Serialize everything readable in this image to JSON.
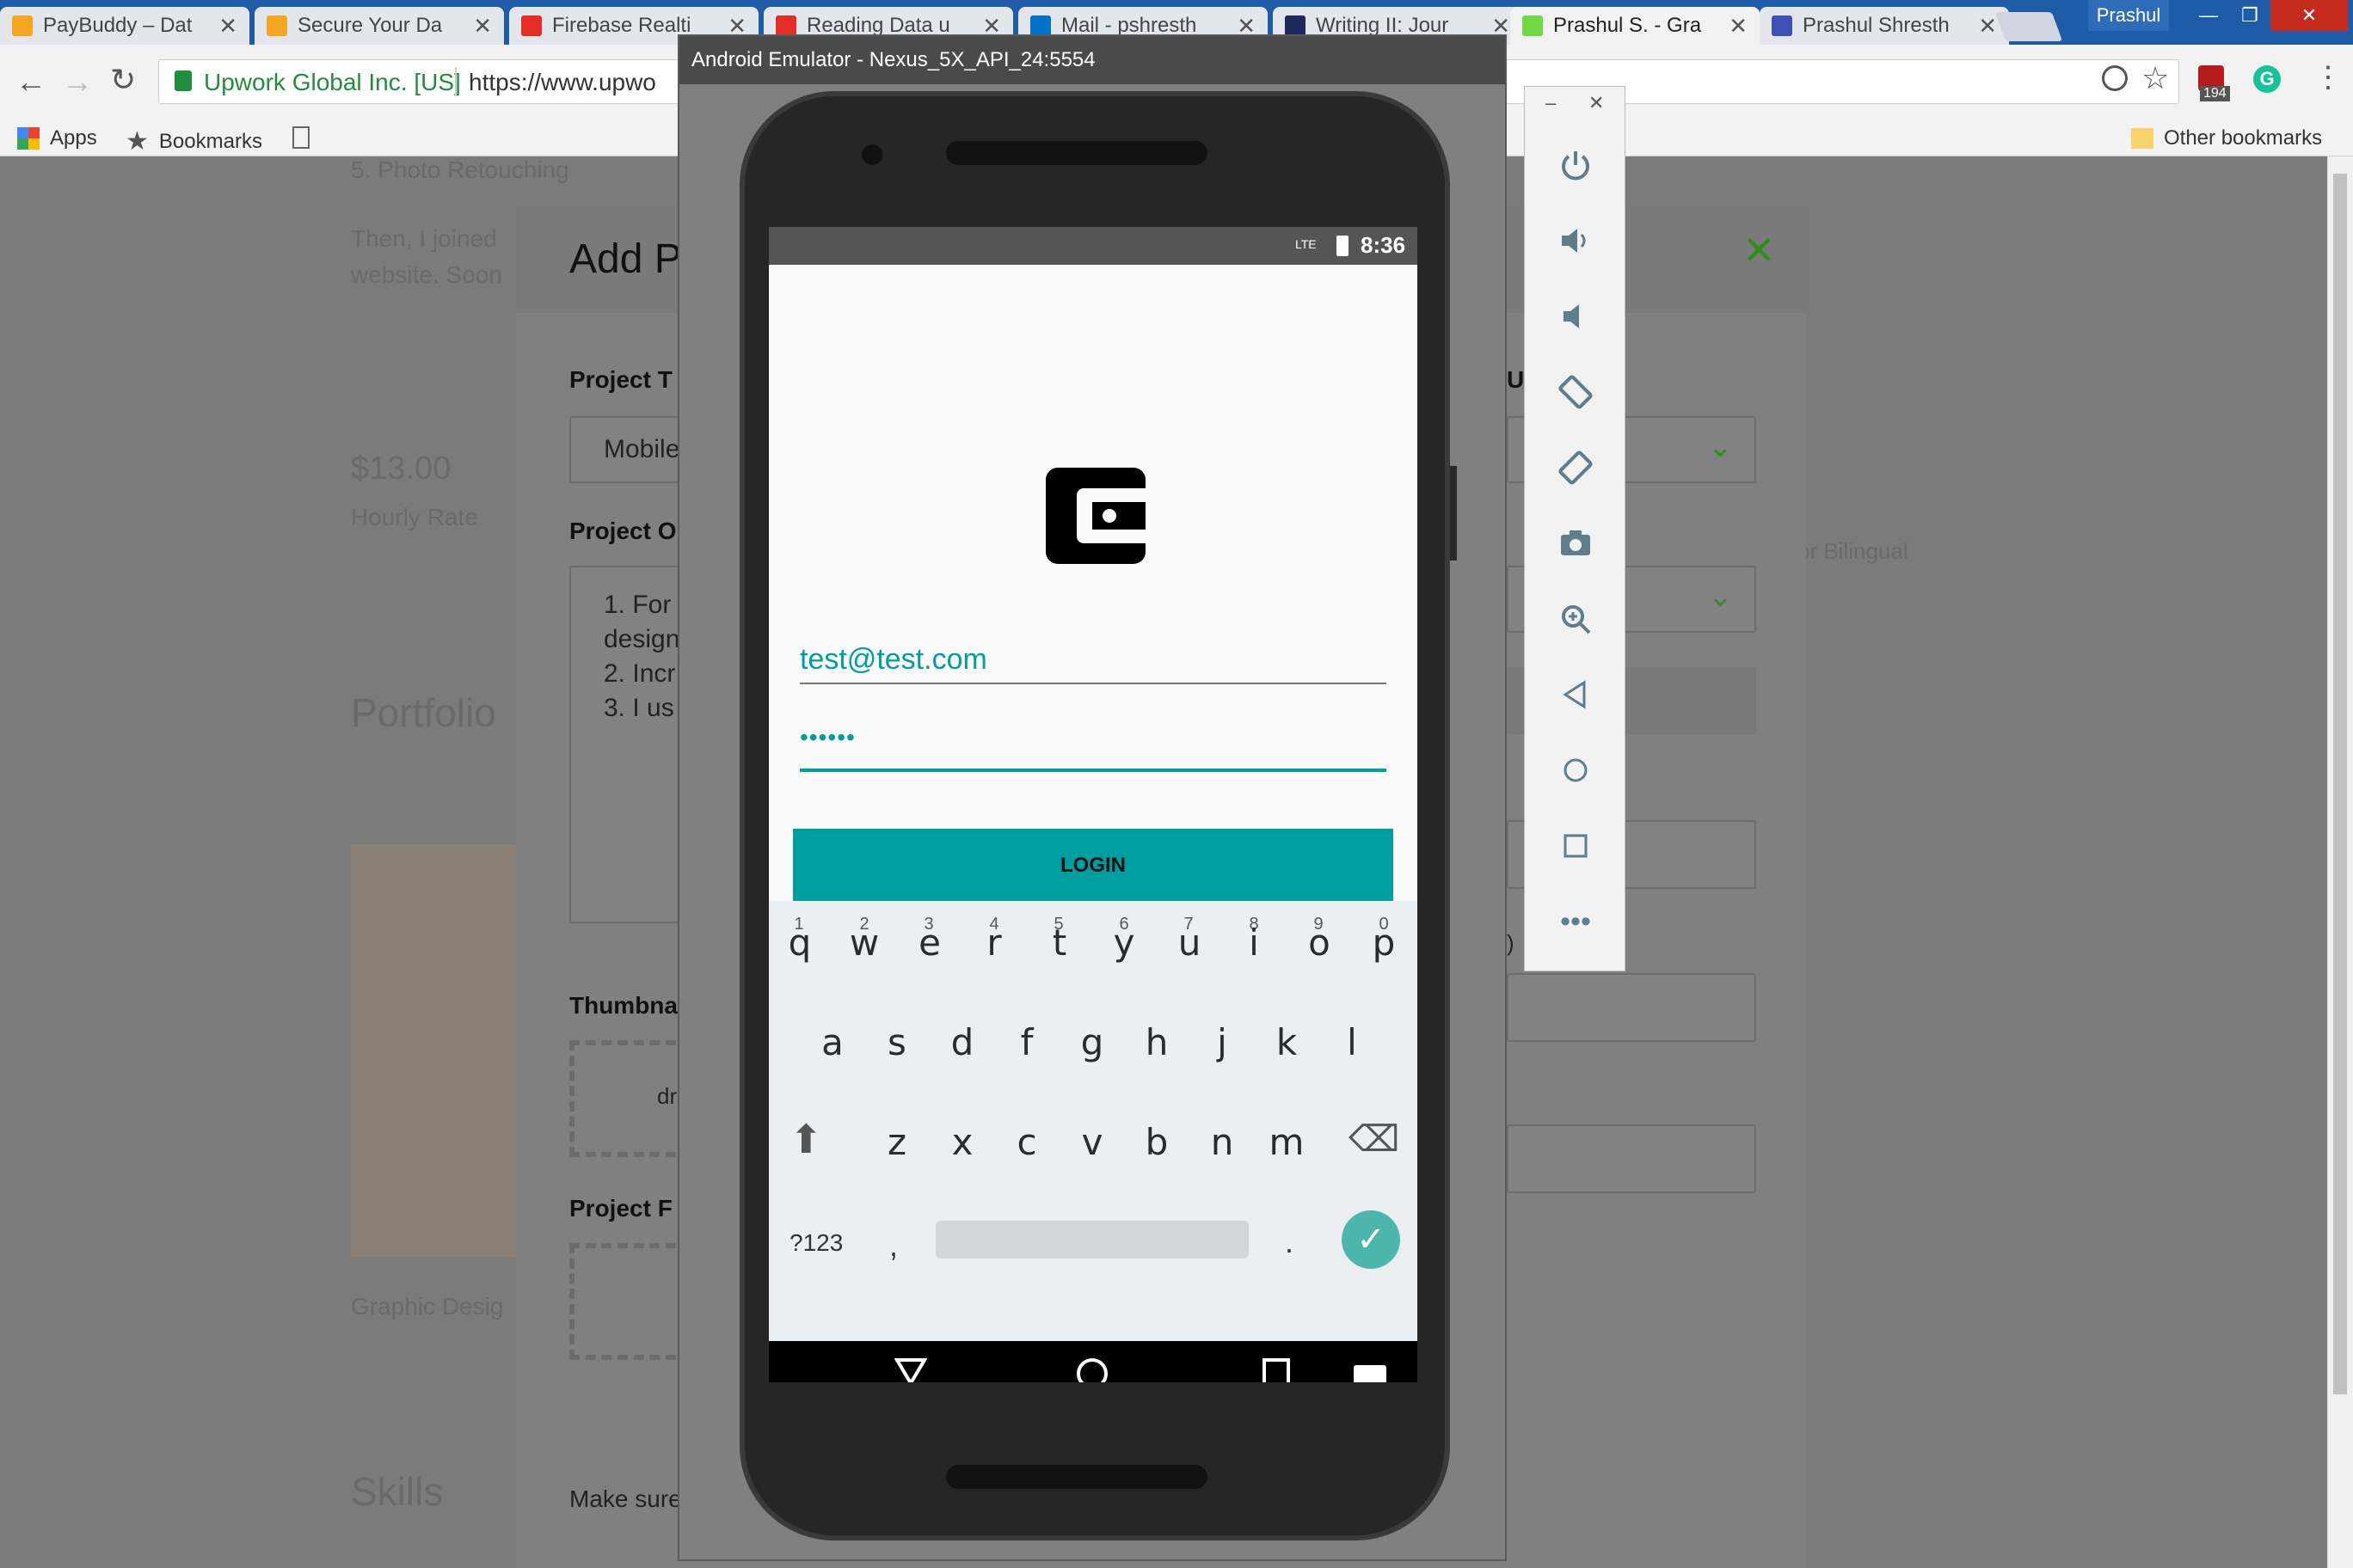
{
  "browser": {
    "tabs": [
      {
        "label": "PayBuddy – Dat",
        "icon": "firebase-icon"
      },
      {
        "label": "Secure Your Da",
        "icon": "firebase-icon"
      },
      {
        "label": "Firebase Realti",
        "icon": "youtube-icon"
      },
      {
        "label": "Reading Data u",
        "icon": "youtube-icon"
      },
      {
        "label": "Mail - pshresth",
        "icon": "outlook-icon"
      },
      {
        "label": "Writing II: Jour",
        "icon": "bookmark-icon"
      },
      {
        "label": "Prashul S. - Gra",
        "icon": "upwork-icon"
      },
      {
        "label": "Prashul Shresth",
        "icon": "site-icon"
      }
    ],
    "profile_name": "Prashul",
    "site_identity": "Upwork Global Inc. [US]",
    "url": "https://www.upwo",
    "extension_badge": "194",
    "bookmarks": {
      "apps": "Apps",
      "bookmarks": "Bookmarks",
      "other": "Other bookmarks"
    }
  },
  "background_page": {
    "item": "5. Photo Retouching",
    "para1": "Then, I joined",
    "para2": "website. Soon",
    "rate": "$13.00",
    "rate_label": "Hourly Rate",
    "portfolio": "Portfolio",
    "graphic": "Graphic Desig",
    "skills": "Skills",
    "bilingual": "or Bilingual"
  },
  "modal": {
    "title": "Add P",
    "project_title_label": "Project T",
    "project_title_value": "Mobile",
    "overview_label": "Project O",
    "overview_lines": [
      "1. For",
      "design",
      "2. Incr",
      "3. I us"
    ],
    "thumbnail_label": "Thumbna",
    "thumbnail_hint": "dr",
    "files_label": "Project F",
    "footer": "Make sure",
    "right_label": "Up",
    "right_paren": ")"
  },
  "emulator": {
    "title": "Android Emulator - Nexus_5X_API_24:5554",
    "status_network": "LTE",
    "time": "8:36",
    "email": "test@test.com",
    "password": "••••••",
    "login": "LOGIN",
    "keyboard": {
      "numbers": [
        "1",
        "2",
        "3",
        "4",
        "5",
        "6",
        "7",
        "8",
        "9",
        "0"
      ],
      "row1": [
        "q",
        "w",
        "e",
        "r",
        "t",
        "y",
        "u",
        "i",
        "o",
        "p"
      ],
      "row2": [
        "a",
        "s",
        "d",
        "f",
        "g",
        "h",
        "j",
        "k",
        "l"
      ],
      "row3": [
        "z",
        "x",
        "c",
        "v",
        "b",
        "n",
        "m"
      ],
      "symbols": "?123",
      "comma": ",",
      "period": "."
    },
    "colors": {
      "accent": "#009e9e",
      "check": "#4db6ac"
    }
  }
}
